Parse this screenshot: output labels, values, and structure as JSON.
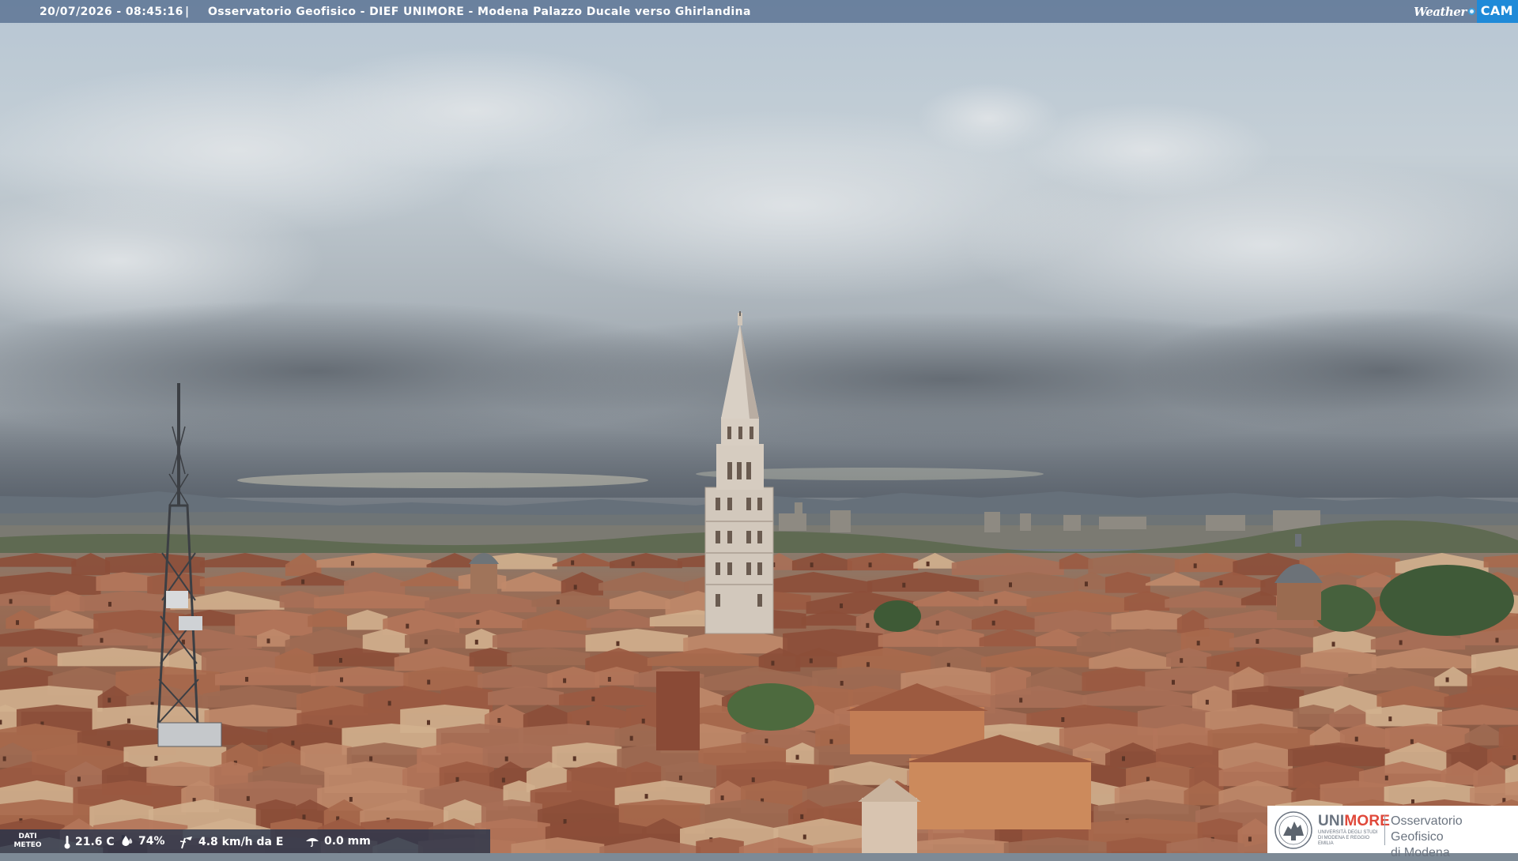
{
  "header": {
    "timestamp": "20/07/2026 - 08:45:16",
    "separator": "|",
    "title": "Osservatorio Geofisico - DIEF UNIMORE - Modena Palazzo Ducale verso Ghirlandina"
  },
  "brand": {
    "weather": "Weather",
    "cam": "CAM",
    "accent_color": "#1f8ad8"
  },
  "meteo": {
    "label_line1": "DATI",
    "label_line2": "METEO",
    "temperature": "21.6 C",
    "humidity": "74%",
    "wind": "4.8 km/h da E",
    "rain": "0.0 mm",
    "icons": [
      "thermometer-icon",
      "humidity-drop-icon",
      "wind-icon",
      "rain-gauge-icon"
    ]
  },
  "logo": {
    "uni_part1": "UNI",
    "uni_part2": "MORE",
    "uni_sub": "UNIVERSITÀ DEGLI STUDI DI MODENA E REGGIO EMILIA",
    "obs_line1": "Osservatorio Geofisico",
    "obs_line2": "di Modena",
    "accent_color": "#e0483a"
  },
  "scene": {
    "subject": "Modena skyline with Ghirlandina tower under cloudy sky",
    "sky_color": "#b9c6d1",
    "roof_color": "#9a5e44"
  }
}
